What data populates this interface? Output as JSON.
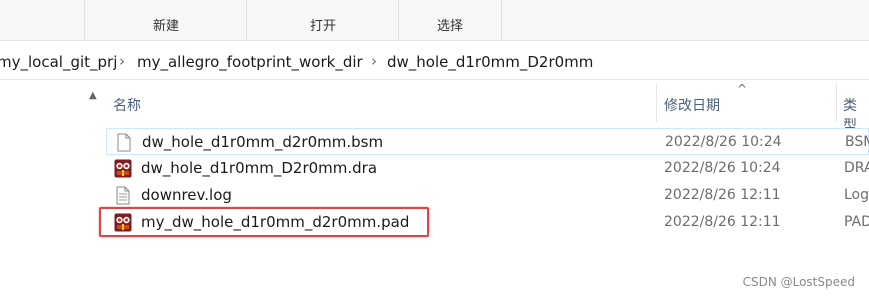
{
  "ribbon": {
    "groups": [
      {
        "label": "新建"
      },
      {
        "label": "打开"
      },
      {
        "label": "选择"
      }
    ]
  },
  "address": {
    "crumbs": [
      "my_local_git_prj",
      "my_allegro_footprint_work_dir",
      "dw_hole_d1r0mm_D2r0mm"
    ]
  },
  "columns": {
    "name": "名称",
    "modified": "修改日期",
    "type": "类型"
  },
  "files": [
    {
      "name": "dw_hole_d1r0mm_d2r0mm.bsm",
      "modified": "2022/8/26 10:24",
      "type": "BSM",
      "icon": "blank-file-icon"
    },
    {
      "name": "dw_hole_d1r0mm_D2r0mm.dra",
      "modified": "2022/8/26 10:24",
      "type": "DRA",
      "icon": "allegro-app-icon"
    },
    {
      "name": "downrev.log",
      "modified": "2022/8/26 12:11",
      "type": "Log",
      "icon": "text-file-icon"
    },
    {
      "name": "my_dw_hole_d1r0mm_d2r0mm.pad",
      "modified": "2022/8/26 12:11",
      "type": "PAD",
      "icon": "allegro-app-icon"
    }
  ],
  "watermark": "CSDN @LostSpeed",
  "colors": {
    "highlight": "#e04545",
    "header_text": "#4c607a",
    "selection_border": "#cce8ff"
  }
}
